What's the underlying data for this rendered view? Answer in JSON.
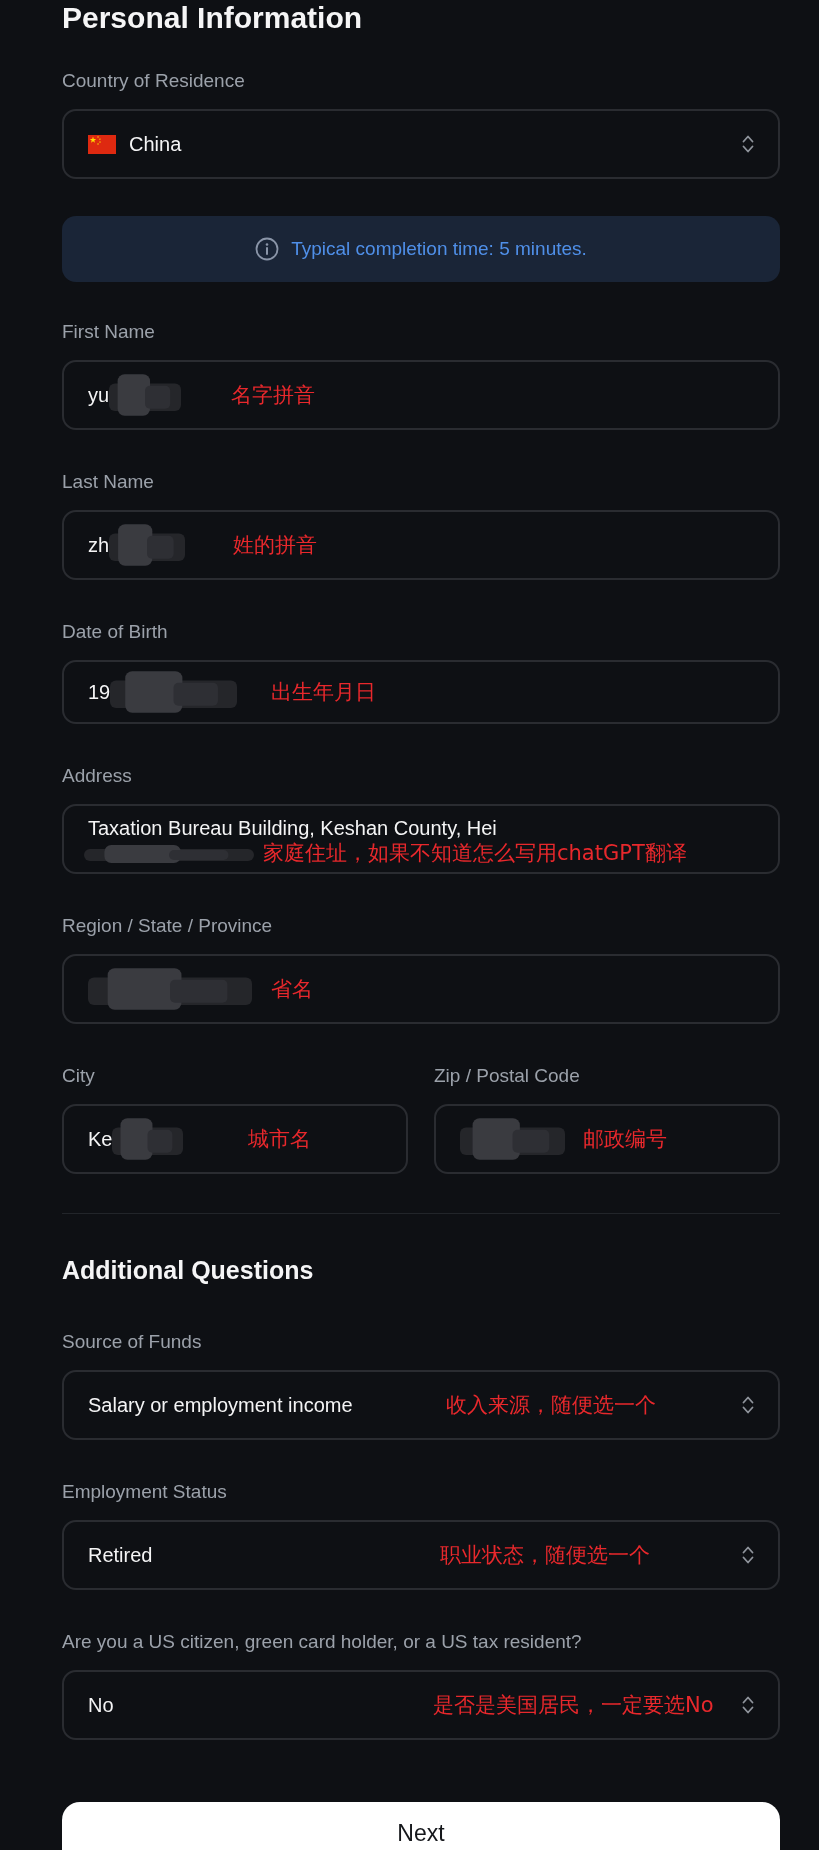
{
  "personal_information": {
    "title": "Personal Information",
    "country": {
      "kind": "country",
      "label": "Country of Residence",
      "value": "China"
    },
    "notice": "Typical completion time: 5 minutes.",
    "fields": [
      {
        "kind": "text",
        "label": "First Name",
        "value": "yu",
        "redacted": true,
        "annotation": "名字拼音"
      },
      {
        "kind": "text",
        "label": "Last Name",
        "value": "zh",
        "redacted": true,
        "annotation": "姓的拼音"
      },
      {
        "kind": "date",
        "label": "Date of Birth",
        "value": "19",
        "redacted": true,
        "annotation": "出生年月日"
      },
      {
        "kind": "address",
        "label": "Address",
        "value": "Taxation Bureau Building, Keshan County, Hei",
        "redacted": true,
        "annotation": "家庭住址，如果不知道怎么写用chatGPT翻译"
      },
      {
        "kind": "text",
        "label": "Region / State / Province",
        "redacted": true,
        "annotation": "省名"
      }
    ],
    "location_row": [
      {
        "kind": "text",
        "label": "City",
        "value": "Ke",
        "redacted": true,
        "annotation": "城市名"
      },
      {
        "kind": "text",
        "label": "Zip / Postal Code",
        "redacted": true,
        "annotation": "邮政编号"
      }
    ]
  },
  "additional_questions": {
    "title": "Additional Questions",
    "fields": [
      {
        "kind": "select",
        "label": "Source of Funds",
        "value": "Salary or employment income",
        "annotation": "收入来源，随便选一个"
      },
      {
        "kind": "select",
        "label": "Employment Status",
        "value": "Retired",
        "annotation": "职业状态，随便选一个"
      },
      {
        "kind": "select",
        "label": "Are you a US citizen, green card holder, or a US tax resident?",
        "value": "No",
        "annotation": "是否是美国居民，一定要选No"
      }
    ]
  },
  "next_button": "Next"
}
